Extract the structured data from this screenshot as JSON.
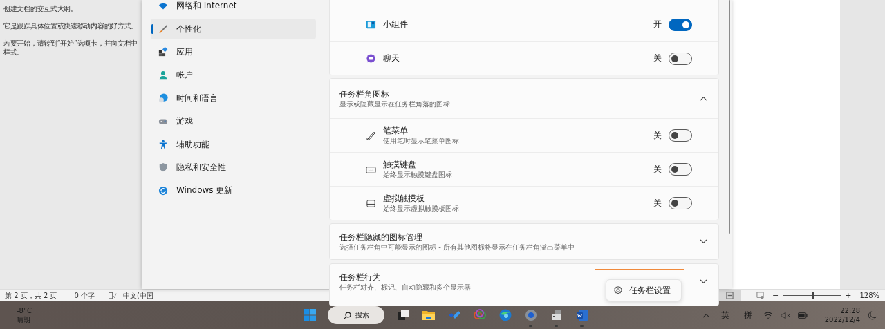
{
  "document": {
    "lines": [
      "创建文档的交互式大纲。",
      "它是跟踪具体位置或快速移动内容的好方式。",
      "若要开始，请转到“开始”选项卡，并向文档中",
      "样式。"
    ]
  },
  "settings": {
    "nav": [
      {
        "label": "网络和 Internet",
        "selected": false
      },
      {
        "label": "个性化",
        "selected": true
      },
      {
        "label": "应用",
        "selected": false
      },
      {
        "label": "帐户",
        "selected": false
      },
      {
        "label": "时间和语言",
        "selected": false
      },
      {
        "label": "游戏",
        "selected": false
      },
      {
        "label": "辅助功能",
        "selected": false
      },
      {
        "label": "隐私和安全性",
        "selected": false
      },
      {
        "label": "Windows 更新",
        "selected": false
      }
    ],
    "groups": [
      {
        "rows": [
          {
            "label": "小组件",
            "state": "开",
            "on": true
          },
          {
            "label": "聊天",
            "state": "关",
            "on": false
          }
        ]
      },
      {
        "title": "任务栏角图标",
        "subtitle": "显示或隐藏显示在任务栏角落的图标",
        "expanded": true,
        "rows": [
          {
            "label": "笔菜单",
            "description": "使用笔时显示笔菜单图标",
            "state": "关",
            "on": false
          },
          {
            "label": "触摸键盘",
            "description": "始终显示触摸键盘图标",
            "state": "关",
            "on": false
          },
          {
            "label": "虚拟触摸板",
            "description": "始终显示虚拟触摸板图标",
            "state": "关",
            "on": false
          }
        ]
      },
      {
        "title": "任务栏隐藏的图标管理",
        "subtitle": "选择任务栏角中可能显示的图标 - 所有其他图标将显示在任务栏角溢出菜单中",
        "expanded": false
      },
      {
        "title": "任务栏行为",
        "subtitle": "任务栏对齐、标记、自动隐藏和多个显示器",
        "expanded": false
      }
    ],
    "popup": {
      "label": "任务栏设置"
    }
  },
  "word_status_bar": {
    "page": "第 2 页，共 2 页",
    "words": "0 个字",
    "language": "中文(中国",
    "zoom_out": "−",
    "zoom": {
      "level": 0.52
    },
    "zoom_in": "+",
    "zoom_percent": "128%"
  },
  "taskbar": {
    "weather": {
      "temperature": "-8°C",
      "condition": "晴朗"
    },
    "search": "搜索",
    "apps": [
      {
        "running": false
      },
      {
        "running": false
      },
      {
        "running": false
      },
      {
        "running": false
      },
      {
        "running": false
      },
      {
        "running": true
      },
      {
        "running": true
      },
      {
        "running": true
      }
    ],
    "input_language": "英",
    "input_method": "拼",
    "time": "22:28",
    "date": "2022/12/4"
  }
}
